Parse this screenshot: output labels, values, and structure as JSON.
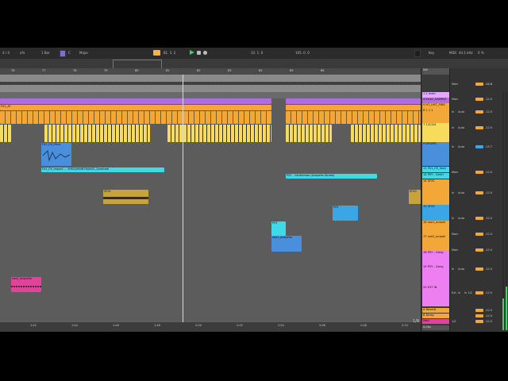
{
  "transport": {
    "signature": "4 / 4",
    "metronome": "o%",
    "quantize": "1 Bar",
    "key_label": "C",
    "scale": "Major",
    "position": "81.  3.  2",
    "loop_start": "33.  1.  0",
    "loop_length": "105.  0.  0",
    "key_button": "Key",
    "midi_label": "MIDI",
    "sample_rate": "44.1 kHz",
    "cpu": "0 %"
  },
  "ruler": [
    "76",
    "77",
    "78",
    "79",
    "80",
    "81",
    "82",
    "83",
    "84",
    "85",
    "86"
  ],
  "time_axis": [
    "1:42",
    "1:44",
    "1:46",
    "1:48",
    "2:00",
    "2:02",
    "2:04",
    "2:06",
    "2:08",
    "2:10"
  ],
  "page_indicator": "1/8",
  "clips": {
    "kick": "Kick",
    "hats": "FX1_AT",
    "fx_impact": "FX1_FX_Impact ... SEKO|VININTRANCE_Zamtrael",
    "fx_pitch": "FX1_FX_Pitch",
    "gentleman": "PSY - Gentleman (Acapella Studio)",
    "sfx1": "SFX1",
    "sfx2": "SFX2",
    "vox1": "PSY",
    "vox2": "PSY",
    "vox3": "vox1_acapella",
    "vox4": "vox2_acapella"
  },
  "headers": {
    "set": "Set",
    "t1": "1 1 main",
    "t2": "2 2 loops",
    "t3": "3 SE",
    "t4": "4 Kick1_SAMPLE",
    "t5": "5 HT_UHT_SINE",
    "t6": "6 1 1 1",
    "t7": "7 1/2/3/4",
    "t8": "8 KICK 4+4",
    "t9": "9 DRUMS",
    "t10": "10 FX1 OWN",
    "t11": "11 FX1_FX_Impt",
    "t12": "12 PSY - Gentl",
    "t13": "13 PSY - Gangt",
    "t14": "14 SFX1",
    "t15": "15 SFX2",
    "t16": "16 vox1_acapel",
    "t17": "17 vox2_acapel",
    "t18": "18 PSY - Gang",
    "t19": "19 PSY - Gang",
    "t20": "20 EXT IN",
    "ret_a": "A Reverb",
    "ret_b": "B Delay",
    "master": "Main"
  },
  "mixer": {
    "in_label": "In",
    "auto_label": "Auto",
    "off_label": "Off",
    "main_label": "Main",
    "ext_in": "Ext. In",
    "ext_in2": "In 1/2",
    "values": [
      "-12.0",
      "-12.0",
      "-12.0",
      "-12.0",
      "-12.0",
      "-11.0",
      "-12.0",
      "0",
      "-15.7",
      "-12.0",
      "-12.0",
      "-12.0",
      "-12.0",
      "-12.0",
      "-12.0",
      "-12.0",
      "-12.0",
      "-12.0",
      "-12.0"
    ],
    "cue": "1/2"
  },
  "colors": {
    "purple": "#b36be0",
    "orange": "#f3a736",
    "yellow": "#f6dc5a",
    "cyan": "#3fd9e8",
    "blue": "#4a8fdc",
    "pink": "#e0449a",
    "gold": "#c8a23a"
  },
  "bottom_label": "0.00s"
}
